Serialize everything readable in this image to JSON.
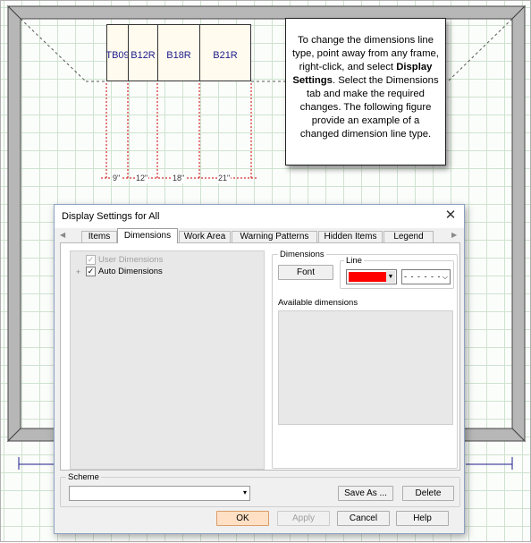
{
  "floorplan": {
    "cabinets": [
      {
        "label": "TB09"
      },
      {
        "label": "B12R"
      },
      {
        "label": "B18R"
      },
      {
        "label": "B21R"
      }
    ],
    "dimensions": [
      "9\"",
      "12\"",
      "18\"",
      "21\""
    ]
  },
  "callout": {
    "text_before": "To change the dimensions line type, point away from any frame, right-click, and select ",
    "bold": "Display Settings",
    "text_after": ". Select the Dimensions tab and make the required changes. The following figure provide an example of a changed dimension line type."
  },
  "dialog": {
    "title": "Display Settings for All",
    "close_glyph": "✕",
    "tabs": [
      "Items",
      "Dimensions",
      "Work Area",
      "Warning Patterns",
      "Hidden Items",
      "Legend"
    ],
    "active_tab": "Dimensions",
    "tree": [
      {
        "label": "User Dimensions",
        "checked": true,
        "disabled": true
      },
      {
        "label": "Auto Dimensions",
        "checked": true,
        "disabled": false,
        "expander": "+"
      }
    ],
    "dimensions_group": {
      "label": "Dimensions",
      "font_button": "Font",
      "line_group_label": "Line",
      "line_color": "#ff0000",
      "line_type": "- - - - - -",
      "available_label": "Available dimensions"
    },
    "scheme": {
      "label": "Scheme",
      "value": "",
      "save_as": "Save As ...",
      "delete": "Delete"
    },
    "buttons": {
      "ok": "OK",
      "apply": "Apply",
      "cancel": "Cancel",
      "help": "Help"
    }
  },
  "colors": {
    "accent": "#ffe0c4",
    "grid": "#cfe3cf",
    "dimension_line": "#cc0000",
    "cabinet_text": "#1c1c8c"
  }
}
